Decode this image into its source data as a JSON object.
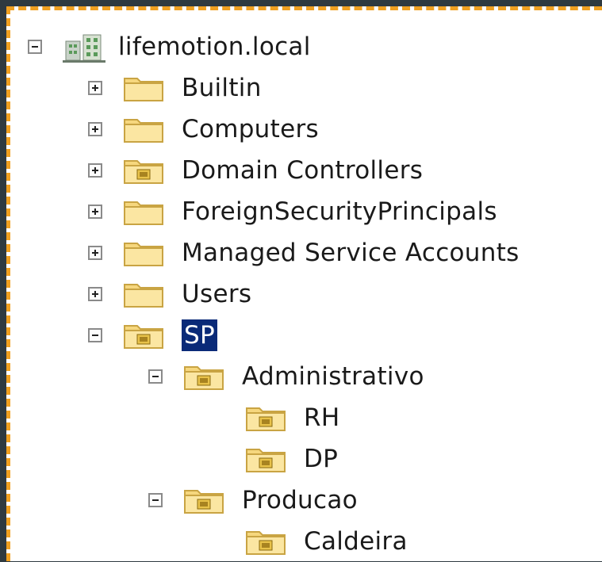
{
  "tree": {
    "root": {
      "label": "lifemotion.local",
      "expanded": true,
      "icon": "domain-icon"
    },
    "items": [
      {
        "label": "Builtin",
        "expanded": false,
        "icon": "folder-icon"
      },
      {
        "label": "Computers",
        "expanded": false,
        "icon": "folder-icon"
      },
      {
        "label": "Domain Controllers",
        "expanded": false,
        "icon": "ou-folder-icon"
      },
      {
        "label": "ForeignSecurityPrincipals",
        "expanded": false,
        "icon": "folder-icon"
      },
      {
        "label": "Managed Service Accounts",
        "expanded": false,
        "icon": "folder-icon"
      },
      {
        "label": "Users",
        "expanded": false,
        "icon": "folder-icon"
      },
      {
        "label": "SP",
        "expanded": true,
        "selected": true,
        "icon": "ou-folder-icon"
      },
      {
        "label": "Administrativo",
        "expanded": true,
        "icon": "ou-folder-icon"
      },
      {
        "label": "RH",
        "icon": "ou-folder-icon"
      },
      {
        "label": "DP",
        "icon": "ou-folder-icon"
      },
      {
        "label": "Producao",
        "expanded": true,
        "icon": "ou-folder-icon"
      },
      {
        "label": "Caldeira",
        "icon": "ou-folder-icon"
      }
    ]
  },
  "colors": {
    "selection": "#0a2a78",
    "frame_border": "#f0a020",
    "outer_background": "#2f3a40",
    "folder": "#f6d77e"
  }
}
